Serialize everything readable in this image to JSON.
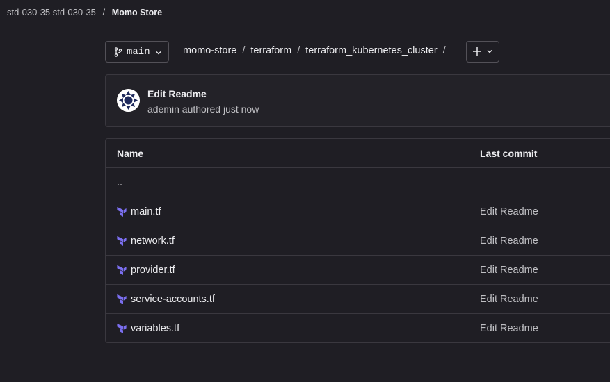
{
  "breadcrumb": {
    "group": "std-030-35 std-030-35",
    "separator": "/",
    "project": "Momo Store"
  },
  "branch": {
    "name": "main"
  },
  "path": {
    "segments": [
      "momo-store",
      "terraform",
      "terraform_kubernetes_cluster"
    ],
    "separator": "/"
  },
  "commit": {
    "title": "Edit Readme",
    "meta": "ademin authored just now"
  },
  "table": {
    "headers": {
      "name": "Name",
      "last_commit": "Last commit"
    },
    "parent": "..",
    "rows": [
      {
        "name": "main.tf",
        "commit": "Edit Readme"
      },
      {
        "name": "network.tf",
        "commit": "Edit Readme"
      },
      {
        "name": "provider.tf",
        "commit": "Edit Readme"
      },
      {
        "name": "service-accounts.tf",
        "commit": "Edit Readme"
      },
      {
        "name": "variables.tf",
        "commit": "Edit Readme"
      }
    ]
  },
  "icons": {
    "branch": "git-branch-icon",
    "chevron": "chevron-down-icon",
    "add": "plus-icon",
    "file": "terraform-icon"
  },
  "colors": {
    "background": "#1f1e24",
    "border": "#3a383f",
    "text": "#ececef",
    "muted": "#bfbfc3",
    "terraform": "#7b6ff0"
  }
}
